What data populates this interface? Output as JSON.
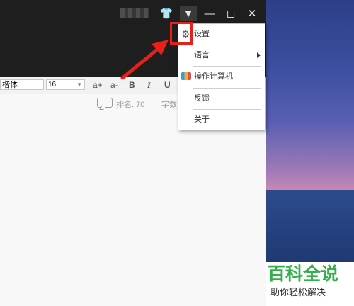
{
  "titlebar": {
    "buttons": [
      {
        "name": "skin-icon",
        "glyph": "👕"
      },
      {
        "name": "menu-icon",
        "glyph": "▼"
      },
      {
        "name": "minimize-icon",
        "glyph": "—"
      },
      {
        "name": "maximize-icon",
        "glyph": "◻"
      },
      {
        "name": "close-icon",
        "glyph": "✕"
      }
    ]
  },
  "toolbar": {
    "font": "楷体",
    "size": "16",
    "buttons": [
      "a+",
      "a-",
      "B",
      "I",
      "U"
    ]
  },
  "status": {
    "rank_label": "排名: 70",
    "words_label": "字数"
  },
  "menu": {
    "items": [
      {
        "label": "设置",
        "icon": "gear-icon"
      },
      {
        "label": "语言",
        "icon": "",
        "submenu": true
      },
      {
        "label": "操作计算机",
        "icon": "calculator-icon"
      },
      {
        "label": "反馈",
        "icon": ""
      },
      {
        "label": "关于",
        "icon": ""
      }
    ]
  },
  "watermark": {
    "title": "百科全说",
    "subtitle": "助你轻松解决"
  },
  "colors": {
    "highlight": "#e8201c",
    "watermark_green": "#34b04a"
  }
}
